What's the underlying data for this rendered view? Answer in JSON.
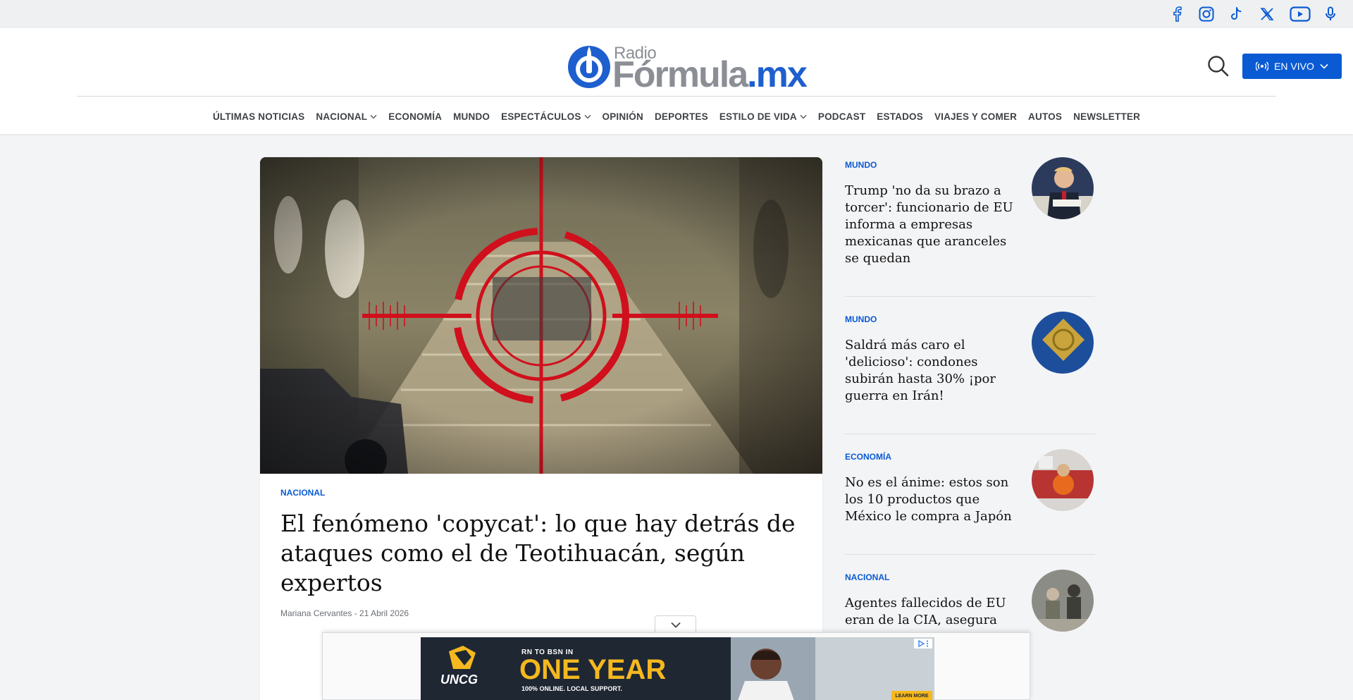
{
  "social": {
    "icons": [
      "facebook-icon",
      "instagram-icon",
      "tiktok-icon",
      "x-icon",
      "youtube-icon",
      "microphone-icon"
    ]
  },
  "logo": {
    "small": "Radio",
    "main": "Fórmula",
    "suffix": ".mx"
  },
  "header": {
    "live_label": "EN VIVO"
  },
  "nav": {
    "items": [
      {
        "label": "ÚLTIMAS NOTICIAS",
        "dropdown": false
      },
      {
        "label": "NACIONAL",
        "dropdown": true
      },
      {
        "label": "ECONOMÍA",
        "dropdown": false
      },
      {
        "label": "MUNDO",
        "dropdown": false
      },
      {
        "label": "ESPECTÁCULOS",
        "dropdown": true
      },
      {
        "label": "OPINIÓN",
        "dropdown": false
      },
      {
        "label": "DEPORTES",
        "dropdown": false
      },
      {
        "label": "ESTILO DE VIDA",
        "dropdown": true
      },
      {
        "label": "PODCAST",
        "dropdown": false
      },
      {
        "label": "ESTADOS",
        "dropdown": false
      },
      {
        "label": "VIAJES Y COMER",
        "dropdown": false
      },
      {
        "label": "AUTOS",
        "dropdown": false
      },
      {
        "label": "NEWSLETTER",
        "dropdown": false
      }
    ]
  },
  "main": {
    "category": "NACIONAL",
    "title": "El fenómeno 'copycat': lo que hay detrás de ataques como el de Teotihuacán, según expertos",
    "byline": "Mariana Cervantes - 21 Abril 2026"
  },
  "side": [
    {
      "category": "MUNDO",
      "title": "Trump 'no da su brazo a torcer': funcionario de EU informa a empresas mexicanas que aranceles se quedan"
    },
    {
      "category": "MUNDO",
      "title": "Saldrá más caro el 'delicioso': condones subirán hasta 30% ¡por guerra en Irán!"
    },
    {
      "category": "ECONOMÍA",
      "title": "No es el ánime: estos son los 10 productos que México le compra a Japón"
    },
    {
      "category": "NACIONAL",
      "title": "Agentes fallecidos de EU eran de la CIA, asegura"
    }
  ],
  "ad": {
    "line1": "RN TO BSN IN",
    "big": "ONE YEAR",
    "line3": "100% ONLINE. LOCAL SUPPORT.",
    "cta": "LEARN MORE",
    "brand": "UNCG"
  },
  "colors": {
    "accent": "#0a5ad4",
    "live_bg": "#0a5ad4",
    "ad_yellow": "#f5b81f"
  }
}
